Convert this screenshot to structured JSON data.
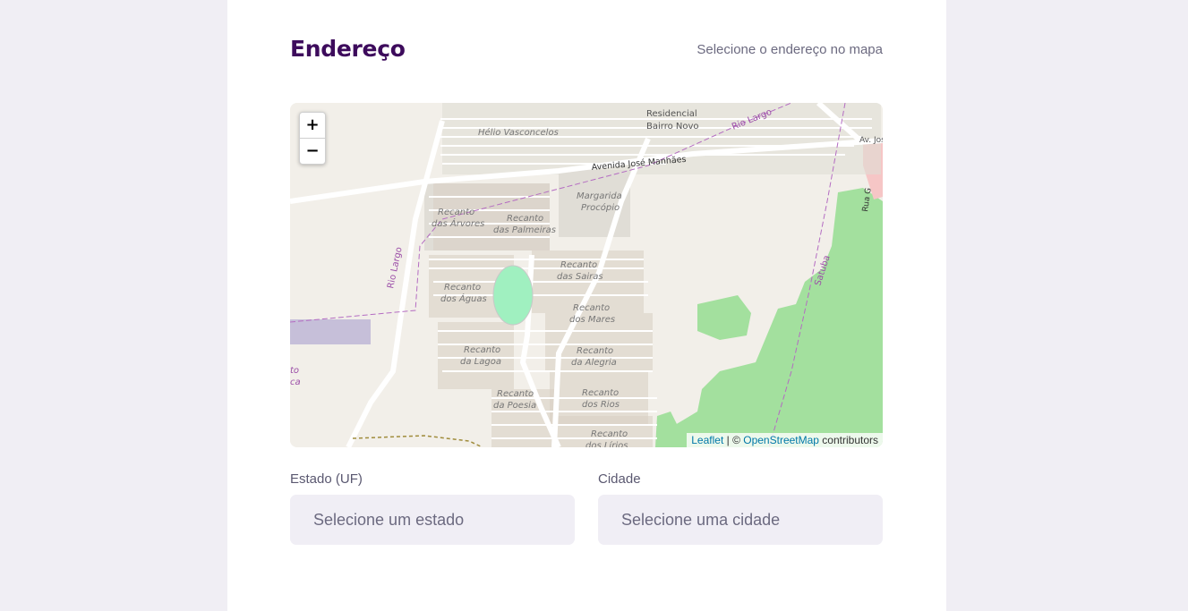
{
  "address": {
    "title": "Endereço",
    "hint": "Selecione o endereço no mapa"
  },
  "map": {
    "zoom_in": "+",
    "zoom_out": "−",
    "attribution": {
      "leaflet": "Leaflet",
      "separator": " | © ",
      "osm": "OpenStreetMap",
      "contributors": " contributors"
    },
    "labels": {
      "residencial": "Residencial",
      "bairro_novo": "Bairro Novo",
      "rio_largo_top": "Rio Largo",
      "av_jo": "Av. Jos",
      "helio": "Hélio Vasconcelos",
      "avenida": "Avenida José Manhães",
      "margarida_1": "Margarida",
      "margarida_2": "Procópio",
      "arvores_1": "Recanto",
      "arvores_2": "das Árvores",
      "palmeiras_1": "Recanto",
      "palmeiras_2": "das Palmeiras",
      "sairas_1": "Recanto",
      "sairas_2": "das Sairas",
      "aguas_1": "Recanto",
      "aguas_2": "dos Águas",
      "mares_1": "Recanto",
      "mares_2": "dos Mares",
      "lagoa_1": "Recanto",
      "lagoa_2": "da Lagoa",
      "alegria_1": "Recanto",
      "alegria_2": "da Alegria",
      "poesia_1": "Recanto",
      "poesia_2": "da Poesia",
      "rios_1": "Recanto",
      "rios_2": "dos Rios",
      "lirios_1": "Recanto",
      "lirios_2": "dos Lírios",
      "rio_largo_left": "Rio Largo",
      "satuba": "Satuba",
      "rua_g": "Rua G",
      "left_cut_1": "to",
      "left_cut_2": "ca"
    }
  },
  "form": {
    "estado": {
      "label": "Estado (UF)",
      "placeholder": "Selecione um estado"
    },
    "cidade": {
      "label": "Cidade",
      "placeholder": "Selecione uma cidade"
    }
  }
}
